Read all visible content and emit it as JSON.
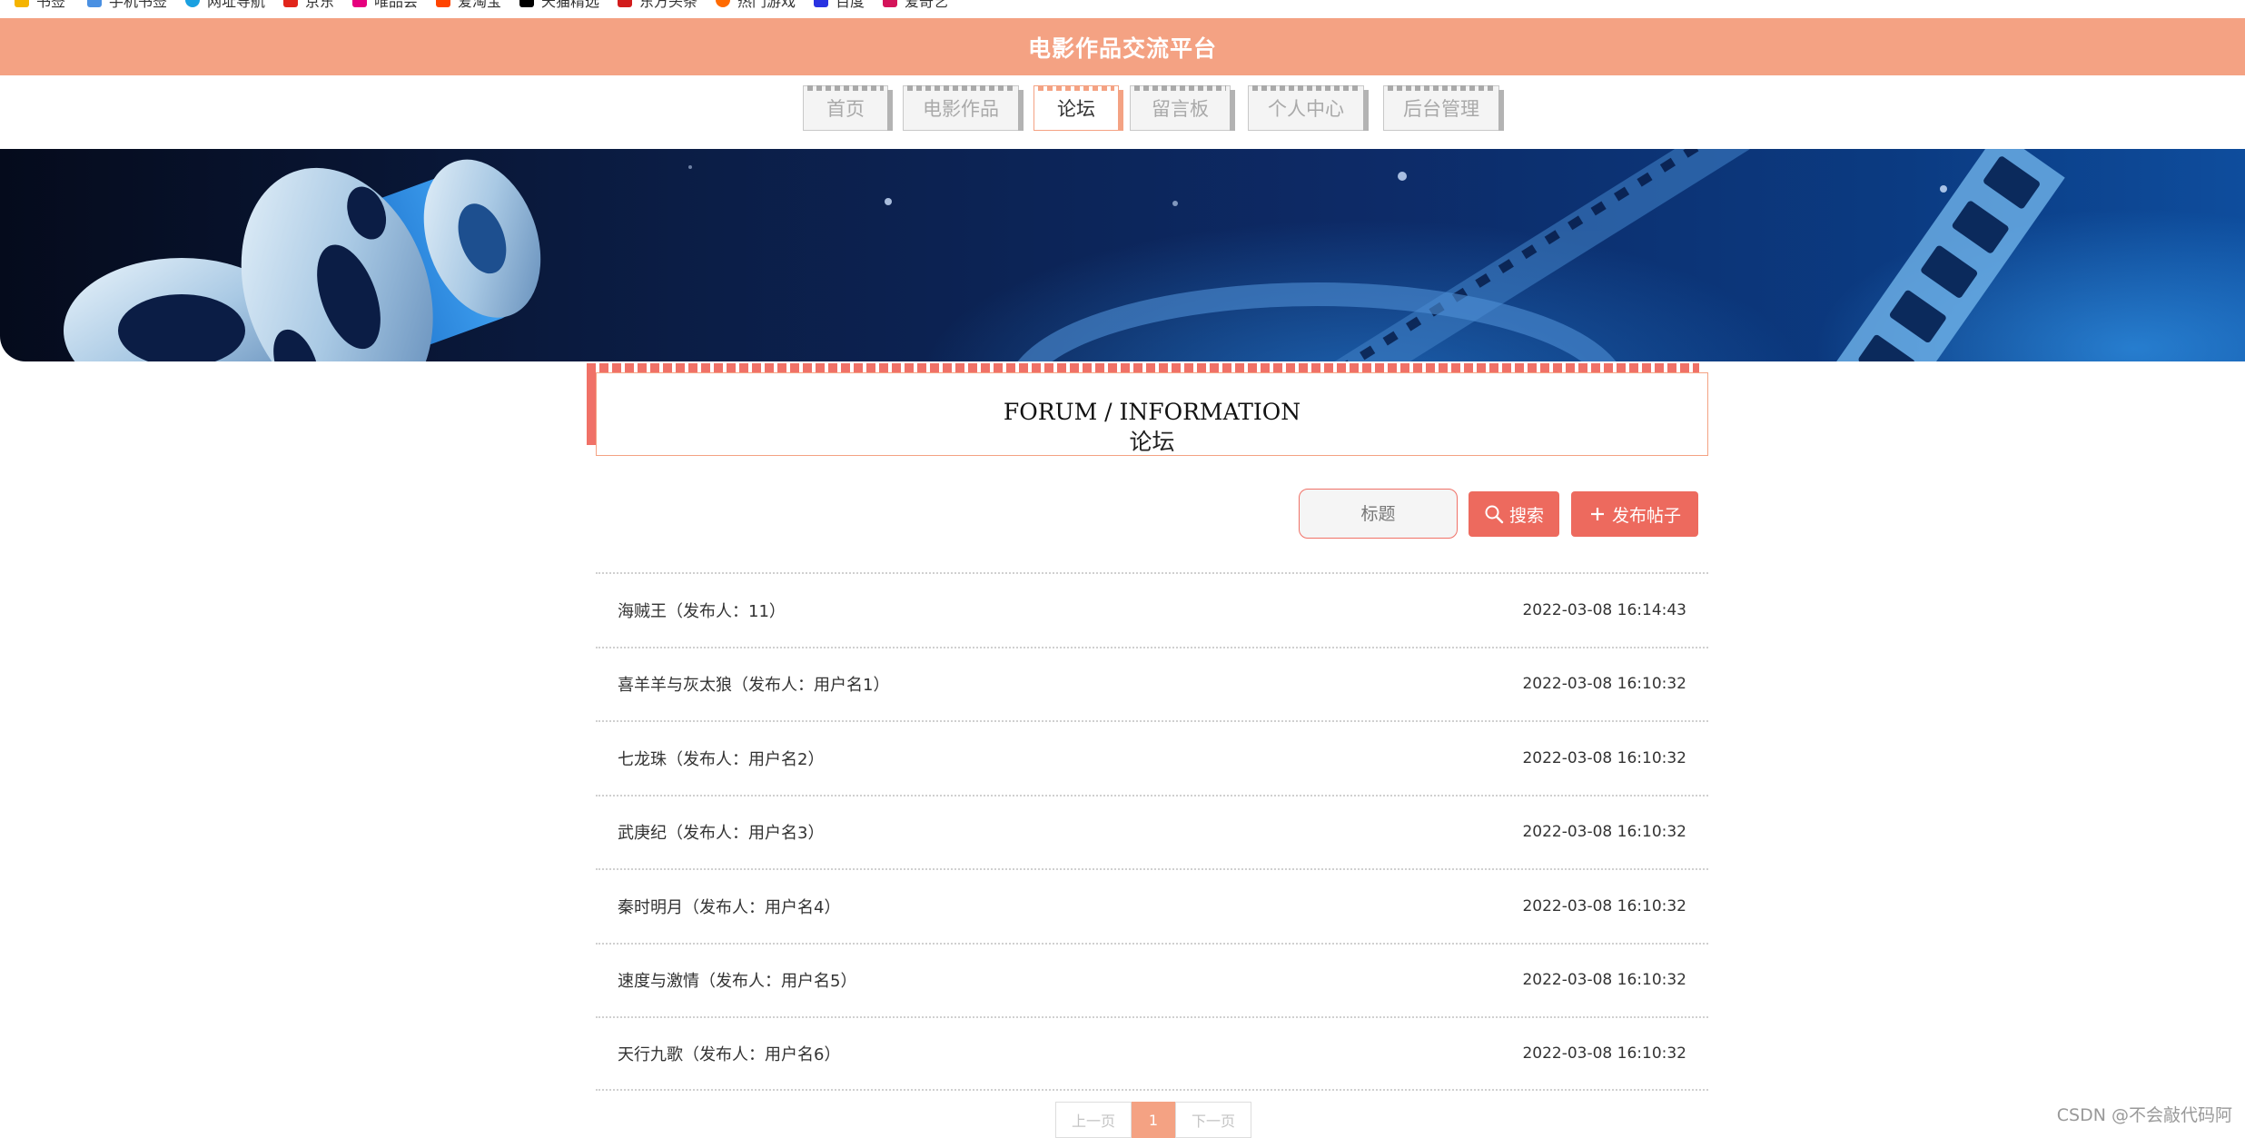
{
  "bookmarks": [
    {
      "label": "书签",
      "color": "#f5b400"
    },
    {
      "label": "手机书签",
      "color": "#4a90e2"
    },
    {
      "label": "网址导航",
      "color": "#1aa0e0"
    },
    {
      "label": "京东",
      "color": "#e1251b"
    },
    {
      "label": "唯品会",
      "color": "#e6007e"
    },
    {
      "label": "爱淘宝",
      "color": "#ff4400"
    },
    {
      "label": "天猫精选",
      "color": "#000000"
    },
    {
      "label": "东方头条",
      "color": "#d21c1c"
    },
    {
      "label": "热门游戏",
      "color": "#ff6a00"
    },
    {
      "label": "百度",
      "color": "#2932e1"
    },
    {
      "label": "爱奇艺",
      "color": "#d4145a"
    }
  ],
  "header": {
    "title": "电影作品交流平台"
  },
  "nav": {
    "items": [
      {
        "label": "首页",
        "active": false
      },
      {
        "label": "电影作品",
        "active": false
      },
      {
        "label": "论坛",
        "active": true
      },
      {
        "label": "留言板",
        "active": false
      },
      {
        "label": "个人中心",
        "active": false
      },
      {
        "label": "后台管理",
        "active": false
      }
    ]
  },
  "section": {
    "title_en": "FORUM / INFORMATION",
    "title_cn": "论坛"
  },
  "search": {
    "placeholder": "标题",
    "search_label": "搜索",
    "post_label": "发布帖子"
  },
  "posts": [
    {
      "title": "海贼王（发布人：11）",
      "time": "2022-03-08 16:14:43"
    },
    {
      "title": "喜羊羊与灰太狼（发布人：用户名1）",
      "time": "2022-03-08 16:10:32"
    },
    {
      "title": "七龙珠（发布人：用户名2）",
      "time": "2022-03-08 16:10:32"
    },
    {
      "title": "武庚纪（发布人：用户名3）",
      "time": "2022-03-08 16:10:32"
    },
    {
      "title": "秦时明月（发布人：用户名4）",
      "time": "2022-03-08 16:10:32"
    },
    {
      "title": "速度与激情（发布人：用户名5）",
      "time": "2022-03-08 16:10:32"
    },
    {
      "title": "天行九歌（发布人：用户名6）",
      "time": "2022-03-08 16:10:32"
    }
  ],
  "pagination": {
    "prev": "上一页",
    "current": "1",
    "next": "下一页"
  },
  "watermark": "CSDN @不会敲代码阿",
  "colors": {
    "accent": "#f4a283",
    "button": "#ed6a5e"
  }
}
